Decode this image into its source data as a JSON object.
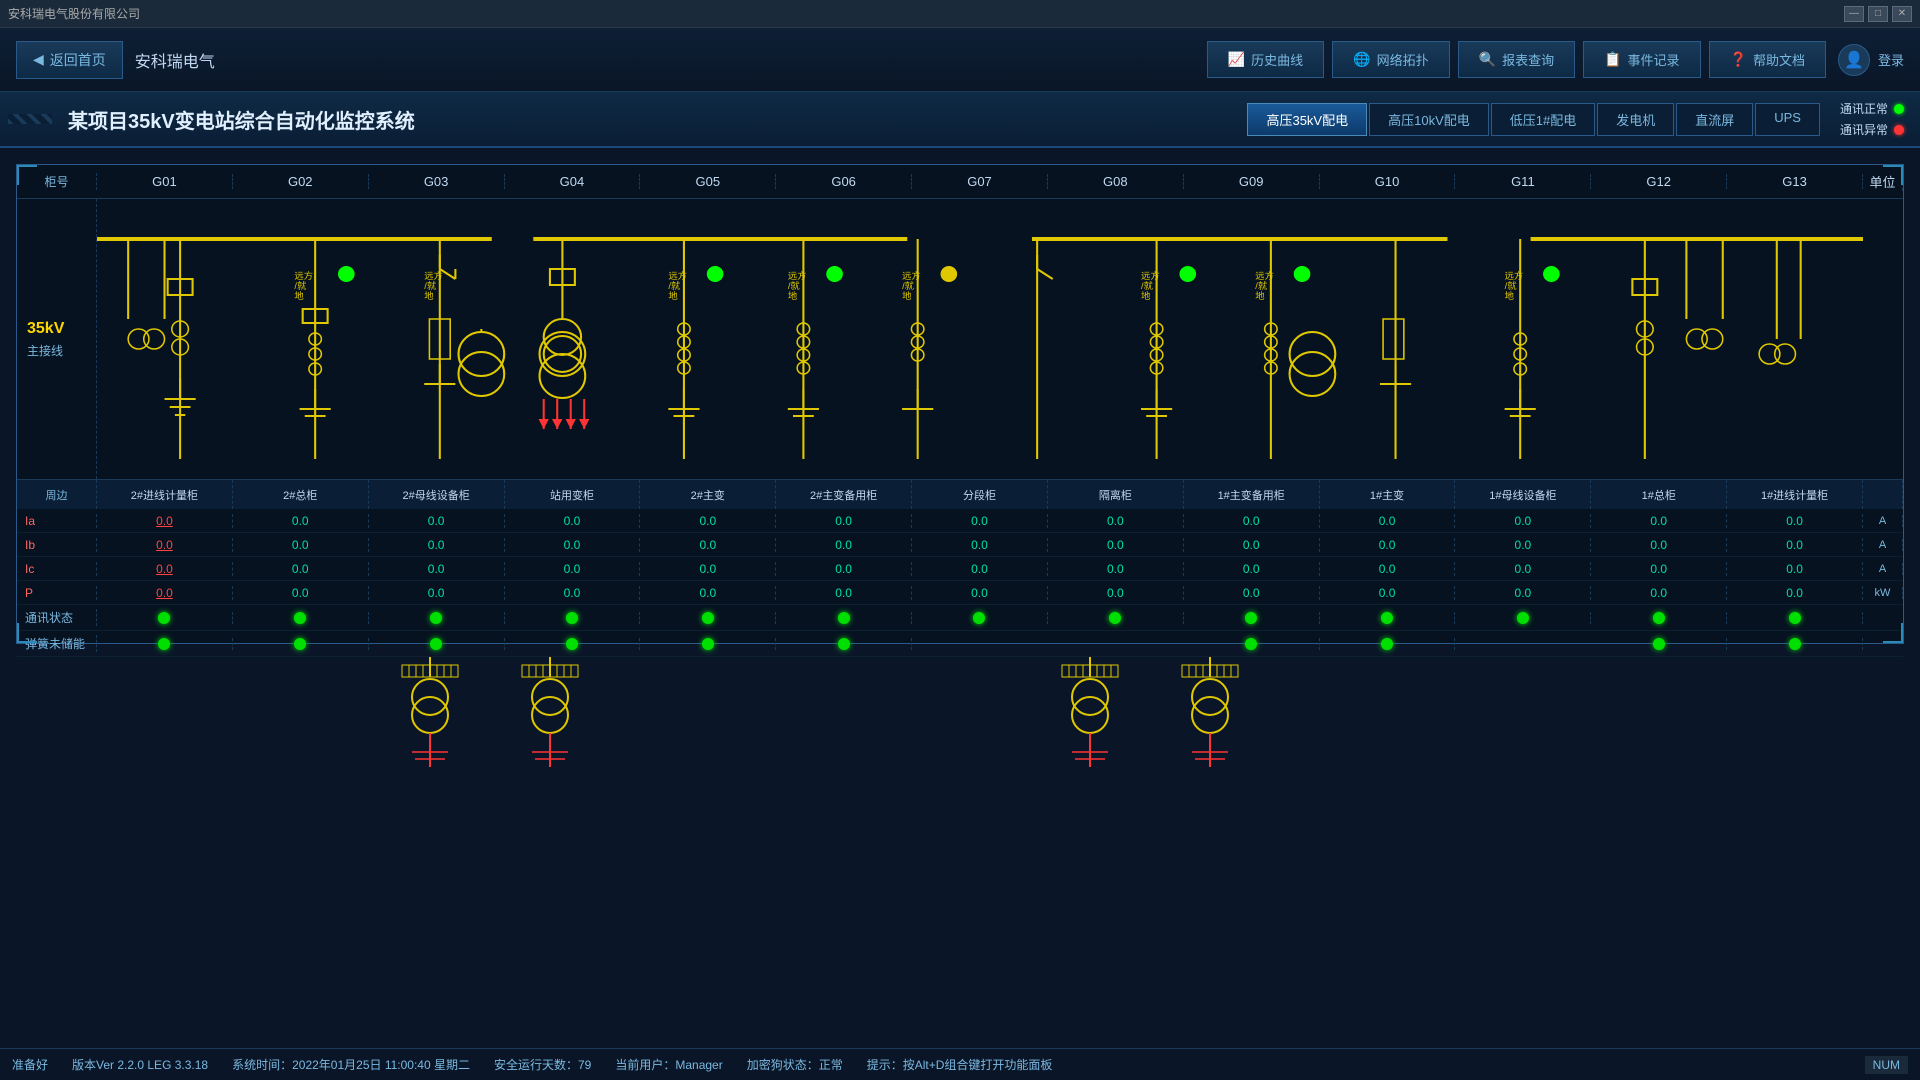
{
  "titleBar": {
    "appName": "安科瑞电气股份有限公司",
    "winControls": [
      "—",
      "□",
      "✕"
    ]
  },
  "topNav": {
    "homeBtn": "返回首页",
    "companyName": "安科瑞电气",
    "navItems": [
      {
        "icon": "📈",
        "label": "历史曲线"
      },
      {
        "icon": "🌐",
        "label": "网络拓扑"
      },
      {
        "icon": "🔍",
        "label": "报表查询"
      },
      {
        "icon": "📋",
        "label": "事件记录"
      },
      {
        "icon": "❓",
        "label": "帮助文档"
      }
    ],
    "loginLabel": "登录"
  },
  "subtitleBar": {
    "systemTitle": "某项目35kV变电站综合自动化监控系统",
    "tabs": [
      {
        "label": "高压35kV配电",
        "active": true
      },
      {
        "label": "高压10kV配电",
        "active": false
      },
      {
        "label": "低压1#配电",
        "active": false
      },
      {
        "label": "发电机",
        "active": false
      },
      {
        "label": "直流屏",
        "active": false
      },
      {
        "label": "UPS",
        "active": false
      }
    ],
    "statusNormal": "通讯正常",
    "statusAbnormal": "通讯异常"
  },
  "diagram": {
    "colLabel": "柜号",
    "unitLabel": "单位",
    "busLabel35": "35kV",
    "mainBusLabel": "主接线",
    "columns": [
      "G01",
      "G02",
      "G03",
      "G04",
      "G05",
      "G06",
      "G07",
      "G08",
      "G09",
      "G10",
      "G11",
      "G12",
      "G13"
    ],
    "cabinetNames": [
      "2#进线计量柜",
      "2#总柜",
      "2#母线设备柜",
      "站用变柜",
      "2#主变",
      "2#主变备用柜",
      "分段柜",
      "隔离柜",
      "1#主变备用柜",
      "1#主变",
      "1#母线设备柜",
      "1#总柜",
      "1#进线计量柜"
    ],
    "measurements": {
      "ia": {
        "label": "Ia",
        "unit": "A",
        "values": [
          "0.0",
          "0.0",
          "0.0",
          "0.0",
          "0.0",
          "0.0",
          "0.0",
          "0.0",
          "0.0",
          "0.0",
          "0.0",
          "0.0",
          "0.0"
        ],
        "g01red": true
      },
      "ib": {
        "label": "Ib",
        "unit": "A",
        "values": [
          "0.0",
          "0.0",
          "0.0",
          "0.0",
          "0.0",
          "0.0",
          "0.0",
          "0.0",
          "0.0",
          "0.0",
          "0.0",
          "0.0",
          "0.0"
        ],
        "g01red": true
      },
      "ic": {
        "label": "Ic",
        "unit": "A",
        "values": [
          "0.0",
          "0.0",
          "0.0",
          "0.0",
          "0.0",
          "0.0",
          "0.0",
          "0.0",
          "0.0",
          "0.0",
          "0.0",
          "0.0",
          "0.0"
        ],
        "g01red": true
      },
      "p": {
        "label": "P",
        "unit": "kW",
        "values": [
          "0.0",
          "0.0",
          "0.0",
          "0.0",
          "0.0",
          "0.0",
          "0.0",
          "0.0",
          "0.0",
          "0.0",
          "0.0",
          "0.0",
          "0.0"
        ],
        "g01red": true
      }
    },
    "statusRows": [
      {
        "label": "通讯状态"
      },
      {
        "label": "弹簧未储能"
      }
    ]
  },
  "statusBar": {
    "ready": "准备好",
    "version": "版本Ver 2.2.0 LEG 3.3.18",
    "systemTime": "系统时间：2022年01月25日  11:00:40  星期二",
    "safeRunDays": "安全运行天数：79",
    "currentUser": "当前用户：Manager",
    "encryptStatus": "加密狗状态：正常",
    "hint": "提示：按Alt+D组合键打开功能面板",
    "numIndicator": "NUM"
  }
}
